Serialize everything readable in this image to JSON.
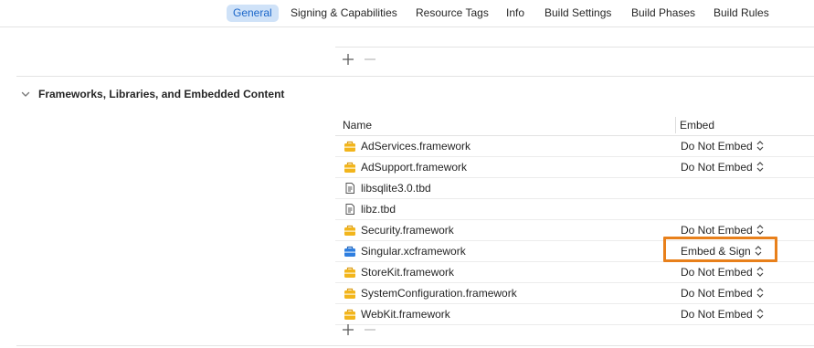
{
  "tabs": [
    {
      "label": "General",
      "active": true
    },
    {
      "label": "Signing & Capabilities"
    },
    {
      "label": "Resource Tags"
    },
    {
      "label": "Info"
    },
    {
      "label": "Build Settings"
    },
    {
      "label": "Build Phases"
    },
    {
      "label": "Build Rules"
    }
  ],
  "section": {
    "title": "Frameworks, Libraries, and Embedded Content",
    "columns": {
      "name": "Name",
      "embed": "Embed"
    },
    "rows": [
      {
        "name": "AdServices.framework",
        "embed": "Do Not Embed",
        "icon": "framework-icon"
      },
      {
        "name": "AdSupport.framework",
        "embed": "Do Not Embed",
        "icon": "framework-icon"
      },
      {
        "name": "libsqlite3.0.tbd",
        "embed": "",
        "icon": "tbd-file-icon"
      },
      {
        "name": "libz.tbd",
        "embed": "",
        "icon": "tbd-file-icon"
      },
      {
        "name": "Security.framework",
        "embed": "Do Not Embed",
        "icon": "framework-icon"
      },
      {
        "name": "Singular.xcframework",
        "embed": "Embed & Sign",
        "icon": "xcframework-icon"
      },
      {
        "name": "StoreKit.framework",
        "embed": "Do Not Embed",
        "icon": "framework-icon"
      },
      {
        "name": "SystemConfiguration.framework",
        "embed": "Do Not Embed",
        "icon": "framework-icon"
      },
      {
        "name": "WebKit.framework",
        "embed": "Do Not Embed",
        "icon": "framework-icon"
      }
    ]
  },
  "colors": {
    "framework": "#f2b51c",
    "xcframework": "#2f7fe0",
    "highlight": "#e8801b",
    "active_tab_bg": "#cfe2f8",
    "active_tab_text": "#1b66c9"
  }
}
